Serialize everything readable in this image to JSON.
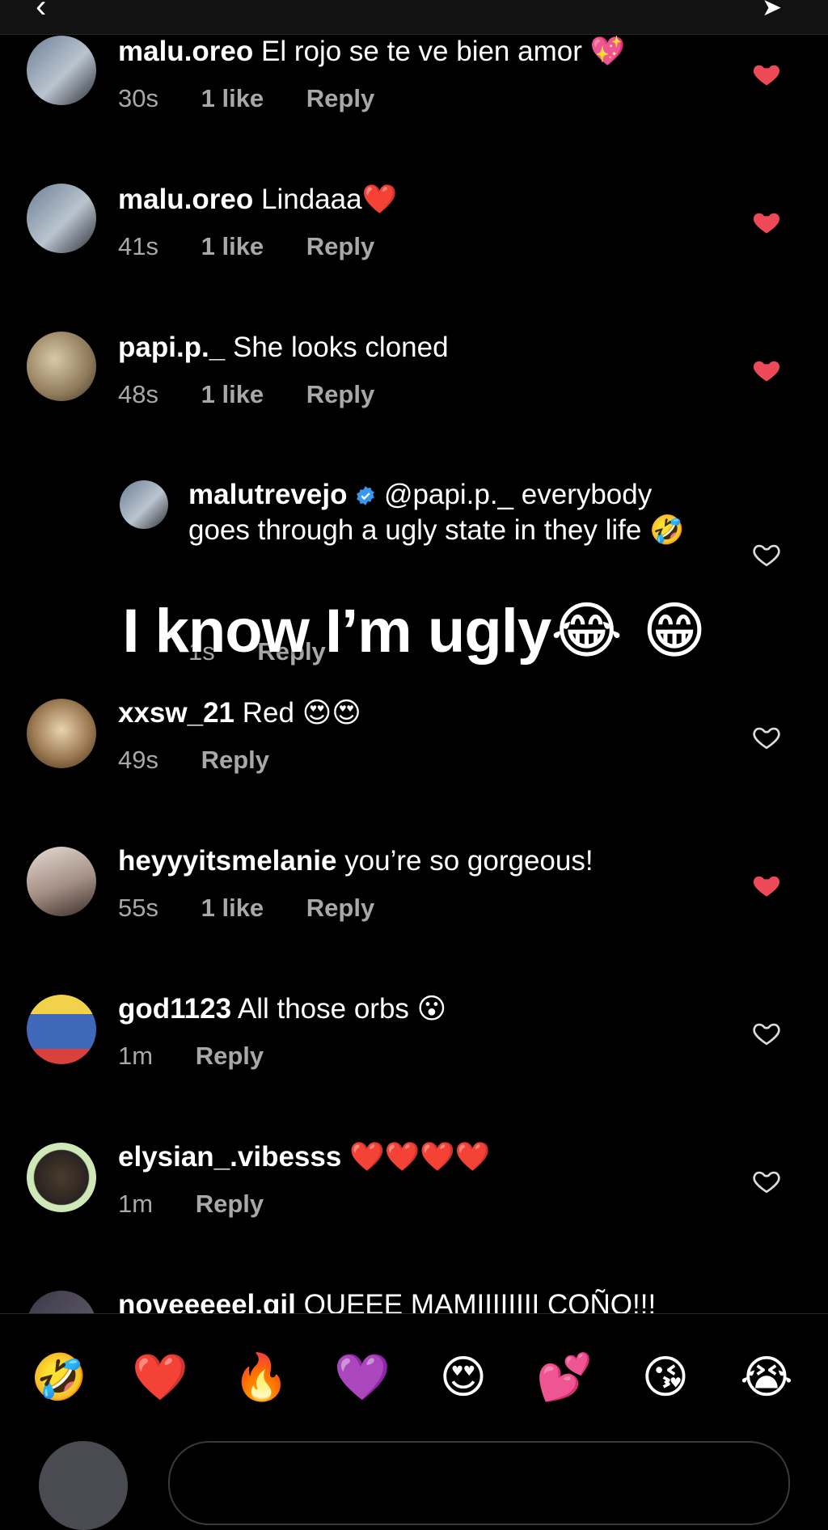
{
  "topbar": {
    "back_icon": "‹",
    "send_icon": "➤"
  },
  "comments": [
    {
      "user": "malu.oreo",
      "text": "El rojo se te ve bien amor",
      "emoji": "💖",
      "time": "30s",
      "likes": "1 like",
      "reply": "Reply",
      "liked": true
    },
    {
      "user": "malu.oreo",
      "text": "Lindaaa",
      "emoji": "❤️",
      "time": "41s",
      "likes": "1 like",
      "reply": "Reply",
      "liked": true
    },
    {
      "user": "papi.p._",
      "text": "She looks cloned",
      "emoji": "",
      "time": "48s",
      "likes": "1 like",
      "reply": "Reply",
      "liked": true
    },
    {
      "user": "malutrevejo",
      "verified": true,
      "text": "@papi.p._ everybody goes through a ugly state in they life",
      "emoji": "🤣",
      "time": "1s",
      "likes": "",
      "reply": "Reply",
      "liked": false
    },
    {
      "user": "xxsw_21",
      "text": "Red",
      "emoji": "😍😍",
      "time": "49s",
      "likes": "",
      "reply": "Reply",
      "liked": false
    },
    {
      "user": "heyyyitsmelanie",
      "text": "you’re so gorgeous!",
      "emoji": "",
      "time": "55s",
      "likes": "1 like",
      "reply": "Reply",
      "liked": true
    },
    {
      "user": "god1123",
      "text": "All those orbs",
      "emoji": "😮",
      "time": "1m",
      "likes": "",
      "reply": "Reply",
      "liked": false
    },
    {
      "user": "elysian_.vibesss",
      "text": "",
      "emoji": "❤️❤️❤️❤️",
      "time": "1m",
      "likes": "",
      "reply": "Reply",
      "liked": false
    },
    {
      "user": "noveeeeel.gil",
      "text": "QUEEE MAMIIIIIIII COÑO!!!",
      "emoji": "",
      "time": "",
      "likes": "",
      "reply": "",
      "liked": false
    }
  ],
  "overlay": {
    "text": "I know I’m ugly",
    "emoji": "😂 😁"
  },
  "reactions": [
    "🤣",
    "❤️",
    "🔥",
    "💜",
    "😍",
    "💕",
    "😘",
    "😭"
  ],
  "colors": {
    "liked": "#ed4956",
    "muted": "#a8a8a8",
    "verified": "#3897f0",
    "background": "#000000"
  }
}
